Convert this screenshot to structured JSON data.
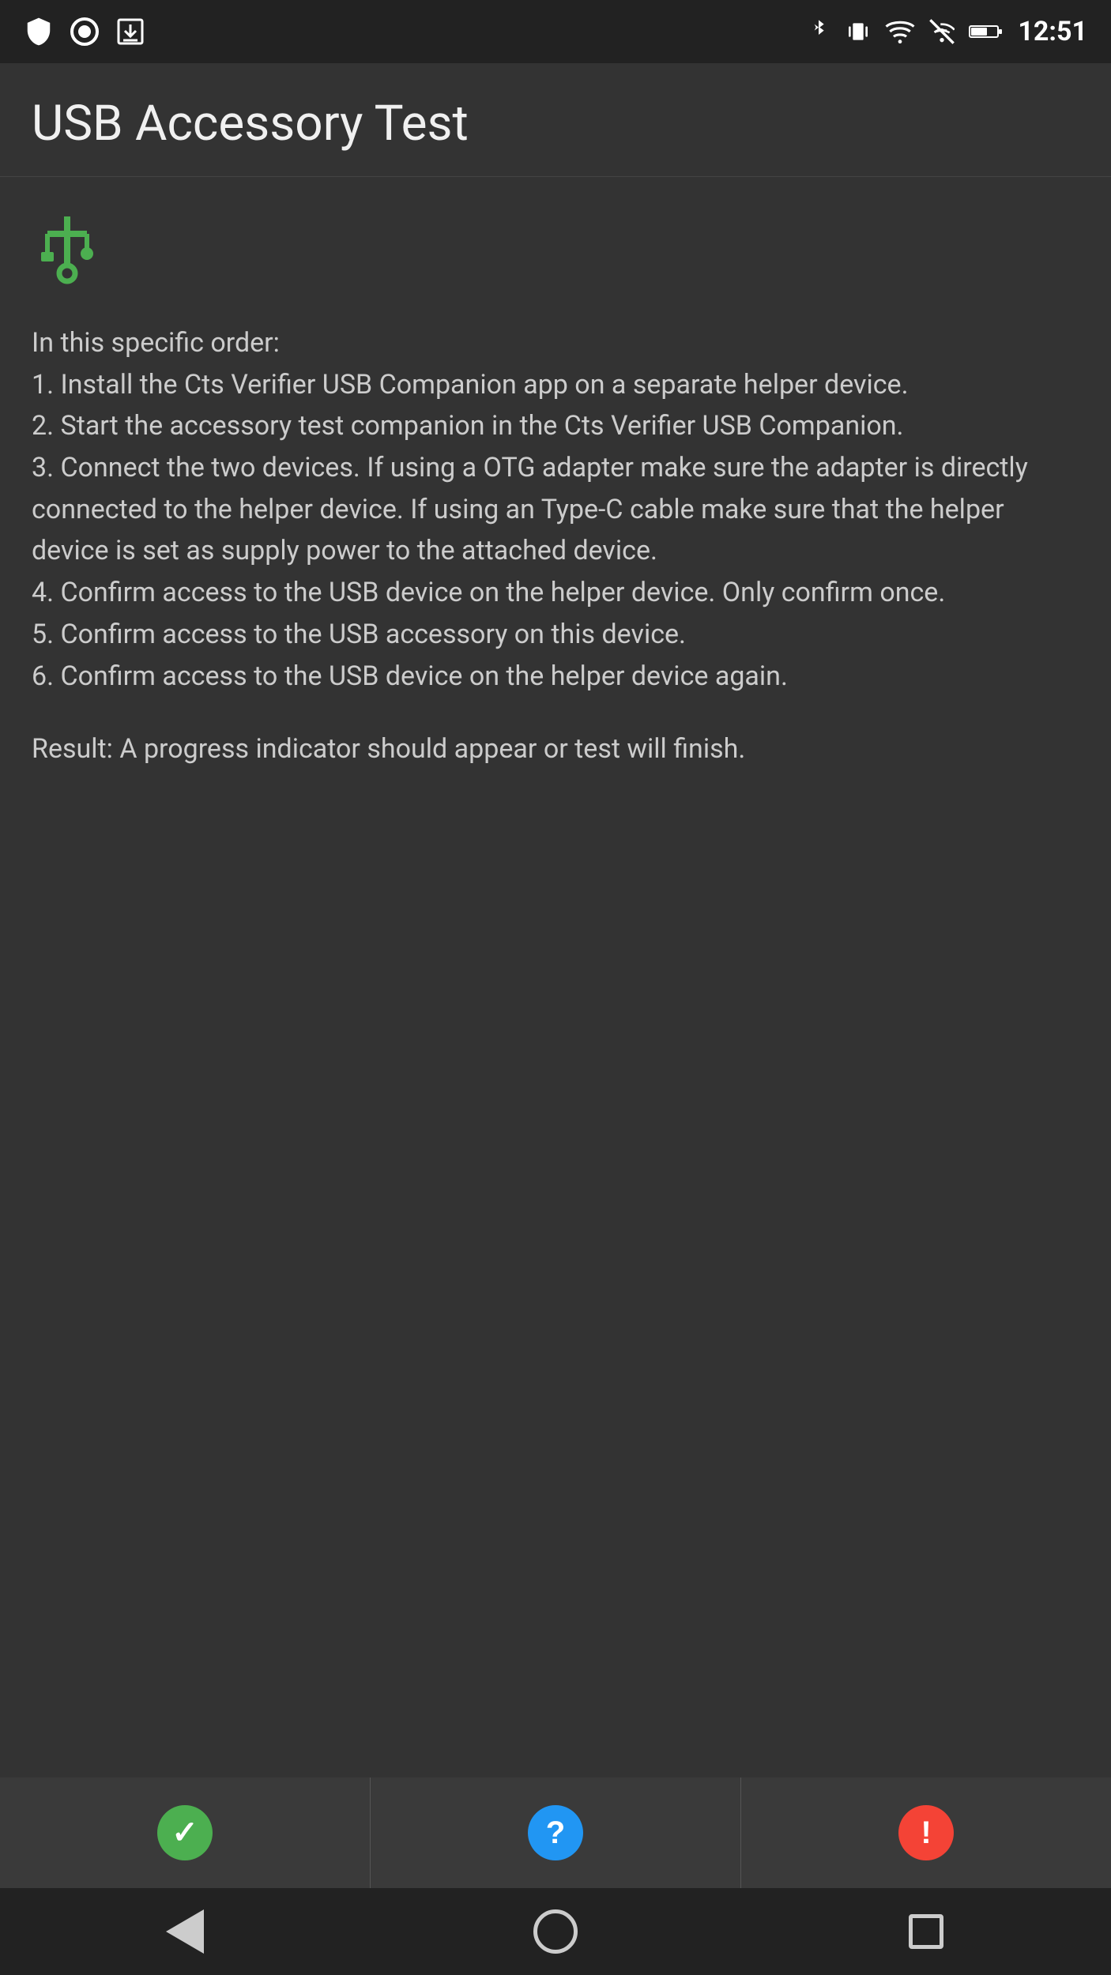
{
  "statusBar": {
    "time": "12:51",
    "leftIcons": [
      "shield",
      "circle",
      "download"
    ],
    "rightIcons": [
      "bluetooth",
      "vibrate",
      "wifi",
      "signal-off",
      "battery"
    ]
  },
  "header": {
    "title": "USB Accessory Test"
  },
  "content": {
    "usbIconLabel": "USB symbol",
    "instructions": "In this specific order:\n1. Install the Cts Verifier USB Companion app on a separate helper device.\n2. Start the accessory test companion in the Cts Verifier USB Companion.\n3. Connect the two devices. If using a OTG adapter make sure the adapter is directly connected to the helper device. If using an Type-C cable make sure that the helper device is set as supply power to the attached device.\n4. Confirm access to the USB device on the helper device. Only confirm once.\n5. Confirm access to the USB accessory on this device.\n6. Confirm access to the USB device on the helper device again.",
    "result": "Result: A progress indicator should appear or test will finish."
  },
  "actionBar": {
    "passLabel": "Pass",
    "infoLabel": "Info",
    "failLabel": "Fail",
    "passSymbol": "✓",
    "infoSymbol": "?",
    "failSymbol": "!"
  },
  "navBar": {
    "backLabel": "Back",
    "homeLabel": "Home",
    "recentLabel": "Recent"
  }
}
